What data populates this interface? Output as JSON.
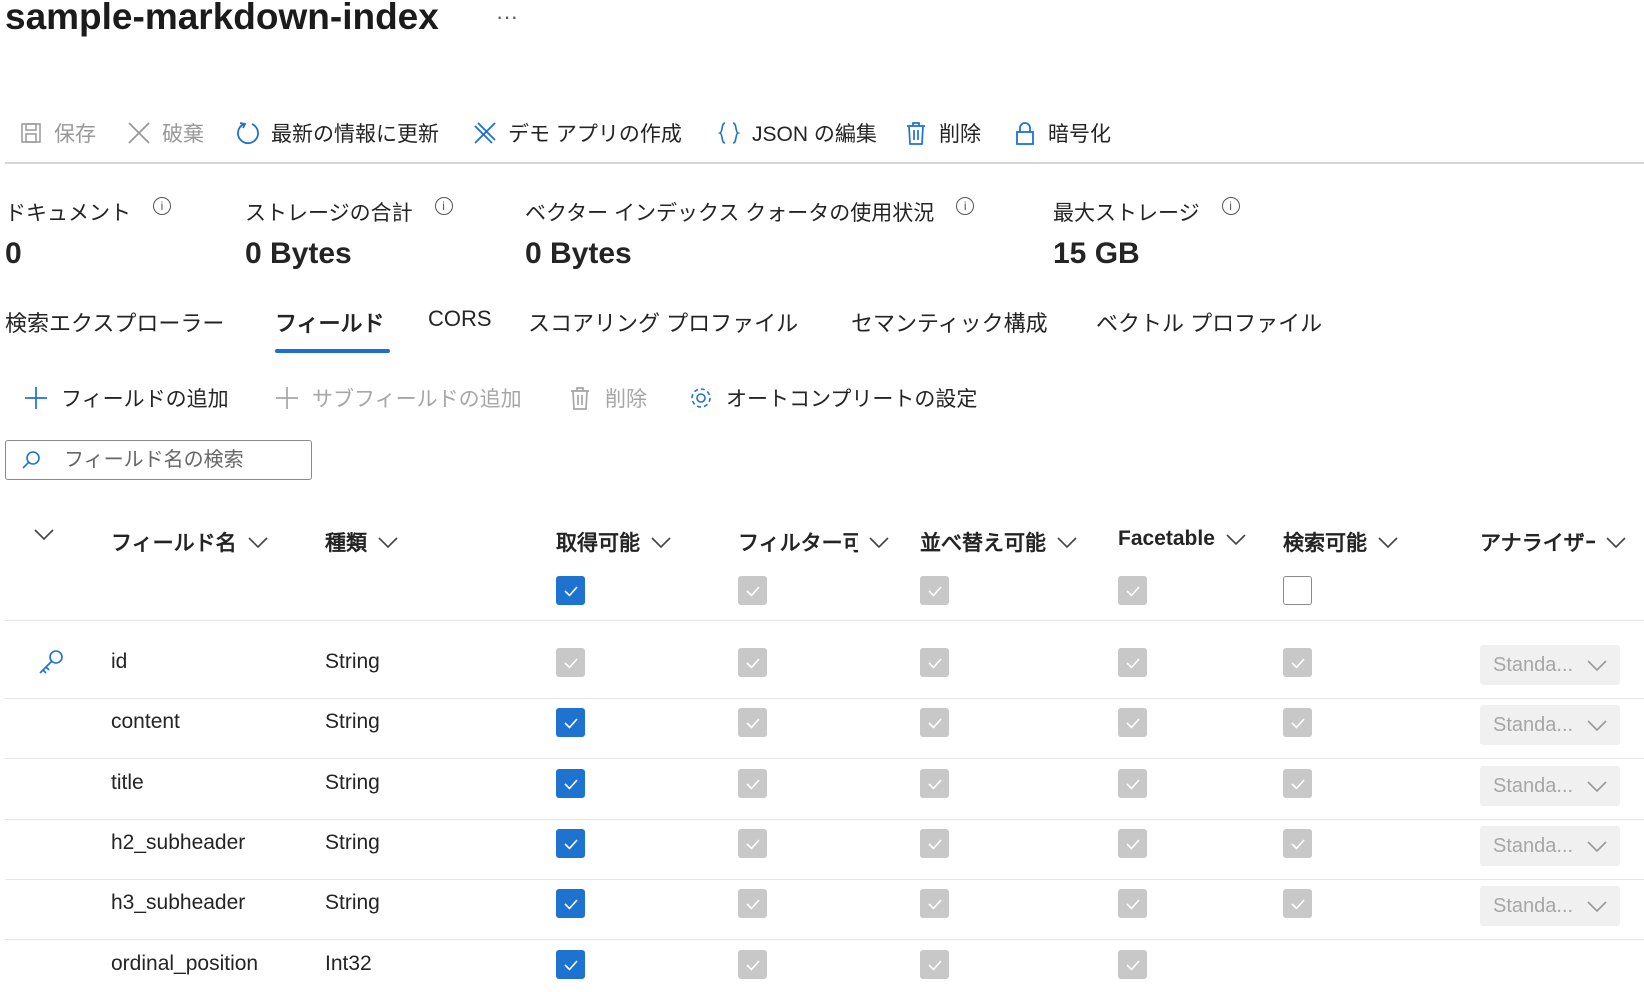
{
  "title": "sample-markdown-index",
  "more_label": "···",
  "toolbar": [
    {
      "label": "保存",
      "icon": "save-icon",
      "disabled": true
    },
    {
      "label": "破棄",
      "icon": "discard-icon",
      "disabled": true
    },
    {
      "label": "最新の情報に更新",
      "icon": "refresh-icon",
      "disabled": false
    },
    {
      "label": "デモ アプリの作成",
      "icon": "demo-app-icon",
      "disabled": false
    },
    {
      "label": "JSON の編集",
      "icon": "json-braces-icon",
      "disabled": false
    },
    {
      "label": "削除",
      "icon": "trash-icon",
      "disabled": false
    },
    {
      "label": "暗号化",
      "icon": "lock-icon",
      "disabled": false
    }
  ],
  "stats": [
    {
      "label": "ドキュメント",
      "value": "0"
    },
    {
      "label": "ストレージの合計",
      "value": "0 Bytes"
    },
    {
      "label": "ベクター インデックス クォータの使用状況",
      "value": "0 Bytes"
    },
    {
      "label": "最大ストレージ",
      "value": "15 GB"
    }
  ],
  "info_glyph": "i",
  "tabs": [
    {
      "label": "検索エクスプローラー"
    },
    {
      "label": "フィールド",
      "active": true
    },
    {
      "label": "CORS"
    },
    {
      "label": "スコアリング プロファイル"
    },
    {
      "label": "セマンティック構成"
    },
    {
      "label": "ベクトル プロファイル"
    }
  ],
  "subtoolbar": [
    {
      "label": "フィールドの追加",
      "icon": "plus-icon",
      "disabled": false
    },
    {
      "label": "サブフィールドの追加",
      "icon": "plus-icon",
      "disabled": true
    },
    {
      "label": "削除",
      "icon": "trash-icon",
      "disabled": true
    },
    {
      "label": "オートコンプリートの設定",
      "icon": "gear-icon",
      "disabled": false
    }
  ],
  "search": {
    "placeholder": "フィールド名の検索",
    "value": ""
  },
  "columns": [
    "フィールド名",
    "種類",
    "取得可能",
    "フィルター可",
    "並べ替え可能",
    "Facetable",
    "検索可能",
    "アナライザー"
  ],
  "header_checks": [
    "checked",
    "disabled",
    "disabled",
    "disabled",
    "empty"
  ],
  "rows": [
    {
      "key": true,
      "name": "id",
      "type": "String",
      "flags": [
        "disabled",
        "disabled",
        "disabled",
        "disabled",
        "disabled"
      ],
      "analyzer": "Standa..."
    },
    {
      "name": "content",
      "type": "String",
      "flags": [
        "checked",
        "disabled",
        "disabled",
        "disabled",
        "disabled"
      ],
      "analyzer": "Standa..."
    },
    {
      "name": "title",
      "type": "String",
      "flags": [
        "checked",
        "disabled",
        "disabled",
        "disabled",
        "disabled"
      ],
      "analyzer": "Standa..."
    },
    {
      "name": "h2_subheader",
      "type": "String",
      "flags": [
        "checked",
        "disabled",
        "disabled",
        "disabled",
        "disabled"
      ],
      "analyzer": "Standa..."
    },
    {
      "name": "h3_subheader",
      "type": "String",
      "flags": [
        "checked",
        "disabled",
        "disabled",
        "disabled",
        "disabled"
      ],
      "analyzer": "Standa..."
    },
    {
      "name": "ordinal_position",
      "type": "Int32",
      "flags": [
        "checked",
        "disabled",
        "disabled",
        "disabled",
        "none"
      ],
      "analyzer": null
    }
  ],
  "colors": {
    "accent": "#1e72d0",
    "disabled_check": "#c8c8c8"
  }
}
